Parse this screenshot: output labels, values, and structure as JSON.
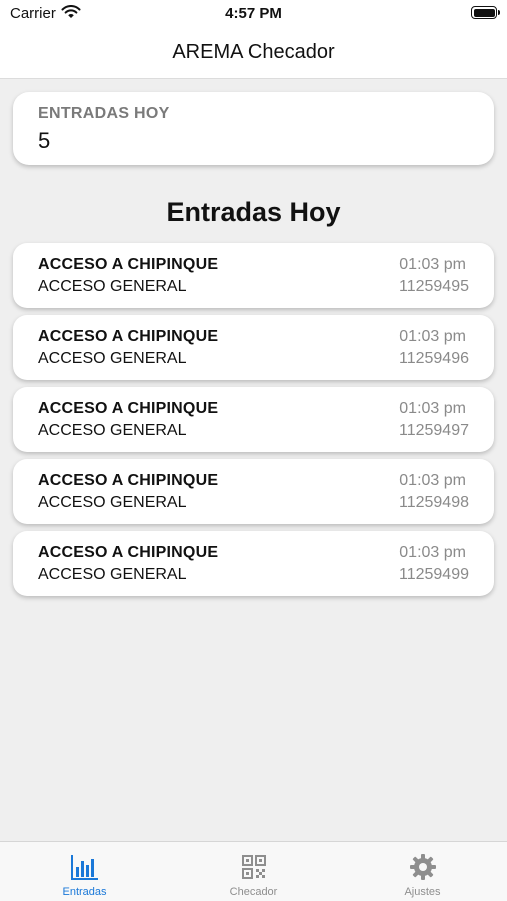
{
  "status_bar": {
    "carrier": "Carrier",
    "time": "4:57 PM"
  },
  "nav": {
    "title": "AREMA Checador"
  },
  "summary": {
    "label": "ENTRADAS HOY",
    "value": "5"
  },
  "section": {
    "title": "Entradas Hoy"
  },
  "entries": [
    {
      "title": "ACCESO A CHIPINQUE",
      "subtitle": "ACCESO GENERAL",
      "time": "01:03 pm",
      "id": "11259495"
    },
    {
      "title": "ACCESO A CHIPINQUE",
      "subtitle": "ACCESO GENERAL",
      "time": "01:03 pm",
      "id": "11259496"
    },
    {
      "title": "ACCESO A CHIPINQUE",
      "subtitle": "ACCESO GENERAL",
      "time": "01:03 pm",
      "id": "11259497"
    },
    {
      "title": "ACCESO A CHIPINQUE",
      "subtitle": "ACCESO GENERAL",
      "time": "01:03 pm",
      "id": "11259498"
    },
    {
      "title": "ACCESO A CHIPINQUE",
      "subtitle": "ACCESO GENERAL",
      "time": "01:03 pm",
      "id": "11259499"
    }
  ],
  "tabs": [
    {
      "label": "Entradas",
      "icon": "bar-chart-icon",
      "active": true
    },
    {
      "label": "Checador",
      "icon": "qr-code-icon",
      "active": false
    },
    {
      "label": "Ajustes",
      "icon": "gear-icon",
      "active": false
    }
  ],
  "colors": {
    "accent": "#1a78d8",
    "inactive": "#8e8e8e",
    "background": "#efefef"
  }
}
